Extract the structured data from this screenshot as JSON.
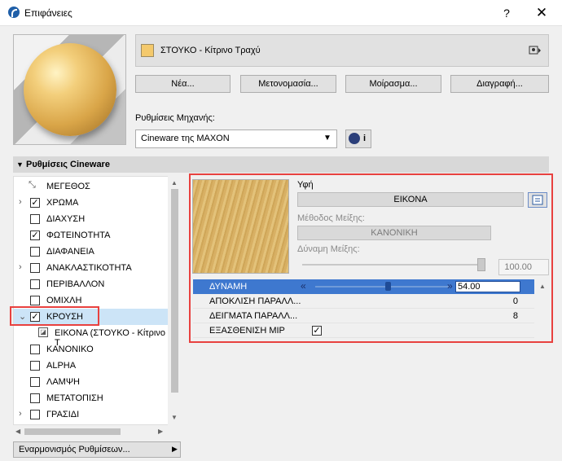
{
  "window": {
    "title": "Επιφάνειες",
    "help": "?",
    "close": "✕"
  },
  "material": {
    "name": "ΣΤΟΥΚΟ - Κίτρινο Τραχύ",
    "swatch_color": "#f4c96c"
  },
  "buttons": {
    "new": "Νέα...",
    "rename": "Μετονομασία...",
    "share": "Μοίρασμα...",
    "delete": "Διαγραφή..."
  },
  "engine": {
    "label": "Ρυθμίσεις Μηχανής:",
    "value": "Cineware της MAXON",
    "info": "i"
  },
  "section": {
    "title": "Ρυθμίσεις Cineware"
  },
  "tree": [
    {
      "label": "ΜΕΓΕΘΟΣ",
      "expand": "",
      "check": ""
    },
    {
      "label": "ΧΡΩΜΑ",
      "expand": "›",
      "check": "✓"
    },
    {
      "label": "ΔΙΑΧΥΣΗ",
      "expand": "",
      "check": ""
    },
    {
      "label": "ΦΩΤΕΙΝΟΤΗΤΑ",
      "expand": "",
      "check": "✓"
    },
    {
      "label": "ΔΙΑΦΑΝΕΙΑ",
      "expand": "",
      "check": ""
    },
    {
      "label": "ΑΝΑΚΛΑΣΤΙΚΟΤΗΤΑ",
      "expand": "›",
      "check": ""
    },
    {
      "label": "ΠΕΡΙΒΑΛΛΟΝ",
      "expand": "",
      "check": ""
    },
    {
      "label": "ΟΜΙΧΛΗ",
      "expand": "",
      "check": ""
    },
    {
      "label": "ΚΡΟΥΣΗ",
      "expand": "⌄",
      "check": "✓"
    },
    {
      "label": "ΕΙΚΟΝΑ (ΣΤΟΥΚΟ - Κίτρινο Τ",
      "expand": "",
      "check": ""
    },
    {
      "label": "ΚΑΝΟΝΙΚΟ",
      "expand": "",
      "check": ""
    },
    {
      "label": "ALPHA",
      "expand": "",
      "check": ""
    },
    {
      "label": "ΛΑΜΨΗ",
      "expand": "",
      "check": ""
    },
    {
      "label": "ΜΕΤΑΤΟΠΙΣΗ",
      "expand": "",
      "check": ""
    },
    {
      "label": "ΓΡΑΣΙΔΙ",
      "expand": "›",
      "check": ""
    }
  ],
  "sync": {
    "label": "Εναρμονισμός Ρυθμίσεων...",
    "arrow": "▶"
  },
  "texture": {
    "label": "Υφή",
    "image_button": "ΕΙΚΟΝΑ",
    "blend_method_label": "Μέθοδος Μείξης:",
    "blend_method_value": "ΚΑΝΟΝΙΚΗ",
    "blend_strength_label": "Δύναμη Μείξης:",
    "blend_strength_value": "100.00",
    "blend_strength_fraction": 1.0
  },
  "params": {
    "strength": {
      "label": "ΔΥΝΑΜΗ",
      "value": "54.00",
      "fraction": 0.54
    },
    "parallax_offset": {
      "label": "ΑΠΟΚΛΙΣΗ ΠΑΡΑΛΛ...",
      "value": "0"
    },
    "parallax_samples": {
      "label": "ΔΕΙΓΜΑΤΑ ΠΑΡΑΛΛ...",
      "value": "8"
    },
    "mip_fade": {
      "label": "ΕΞΑΣΘΕΝΙΣΗ MIP",
      "check": "✓"
    }
  }
}
